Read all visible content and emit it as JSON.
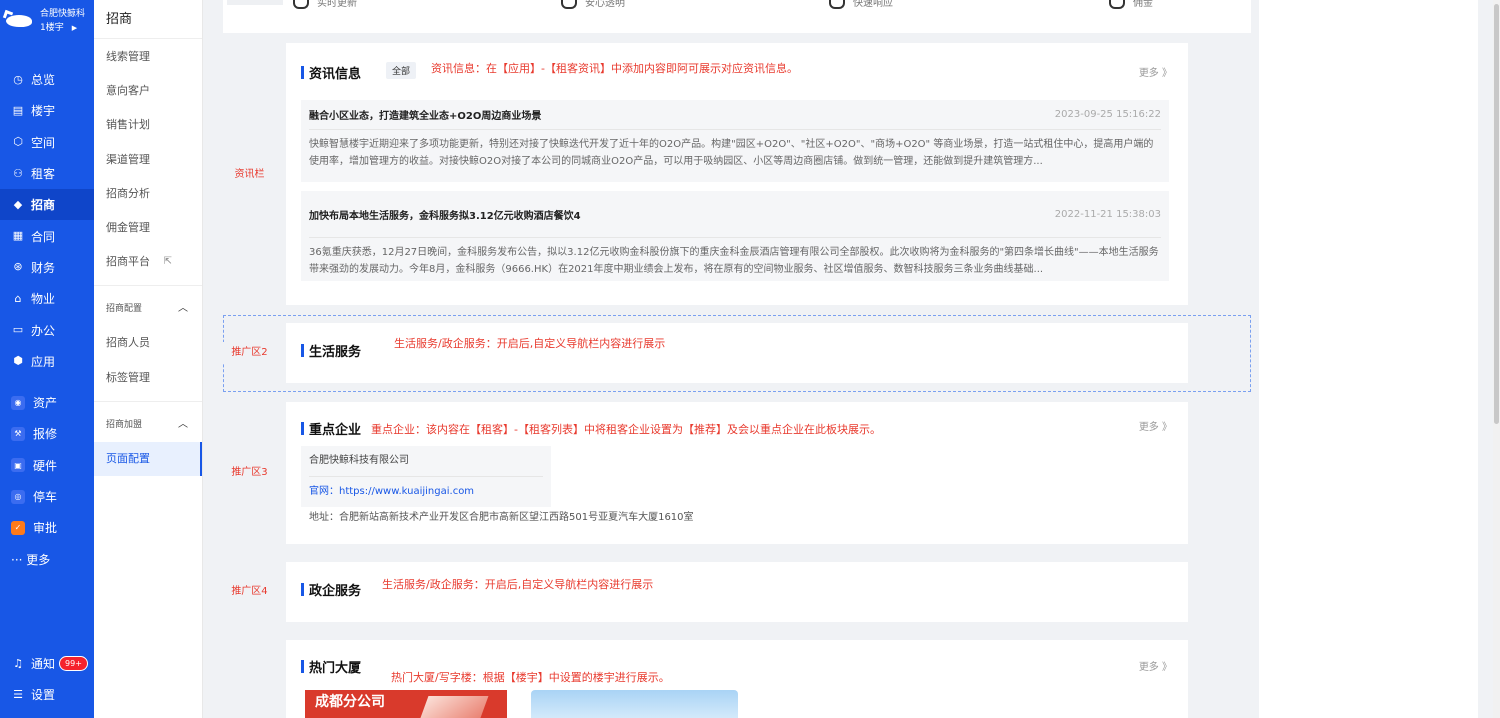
{
  "brand": {
    "name": "合肥快鲸科",
    "sub": "1楼宇"
  },
  "nav": {
    "items": [
      {
        "label": "总览",
        "icon": "clock-icon"
      },
      {
        "label": "楼宇",
        "icon": "building-icon"
      },
      {
        "label": "空间",
        "icon": "cube-icon"
      },
      {
        "label": "租客",
        "icon": "users-icon"
      },
      {
        "label": "招商",
        "icon": "tag-icon"
      },
      {
        "label": "合同",
        "icon": "document-icon"
      },
      {
        "label": "财务",
        "icon": "finance-icon"
      },
      {
        "label": "物业",
        "icon": "home-icon"
      },
      {
        "label": "办公",
        "icon": "monitor-icon"
      },
      {
        "label": "应用",
        "icon": "app-icon"
      }
    ],
    "apps": [
      {
        "label": "资产",
        "color": "#3b6cf0"
      },
      {
        "label": "报修",
        "color": "#3b6cf0"
      },
      {
        "label": "硬件",
        "color": "#3b6cf0"
      },
      {
        "label": "停车",
        "color": "#3b6cf0"
      },
      {
        "label": "审批",
        "color": "#ff7a1a"
      }
    ],
    "more": "··· 更多",
    "notify": "通知",
    "notify_badge": "99+",
    "settings": "设置"
  },
  "sub": {
    "title": "招商",
    "items": [
      "线索管理",
      "意向客户",
      "销售计划",
      "渠道管理",
      "招商分析",
      "佣金管理",
      "招商平台"
    ],
    "group1": "招商配置",
    "group1_items": [
      "招商人员",
      "标签管理"
    ],
    "group2": "招商加盟",
    "group2_items": [
      "页面配置"
    ]
  },
  "top_features": [
    "实时更新",
    "安心透明",
    "快速响应",
    "佣金"
  ],
  "news_section": {
    "tag": "资讯栏",
    "title": "资讯信息",
    "pill": "全部",
    "note": "资讯信息：在【应用】-【租客资讯】中添加内容即阿可展示对应资讯信息。",
    "more": "更多 》",
    "items": [
      {
        "title": "融合小区业态，打造建筑全业态+O2O周边商业场景",
        "time": "2023-09-25 15:16:22",
        "body": "快鲸智慧楼宇近期迎来了多项功能更新，特别还对接了快鲸迭代开发了近十年的O2O产品。构建\"园区+O2O\"、\"社区+O2O\"、\"商场+O2O\" 等商业场景，打造一站式租住中心，提高用户端的使用率，增加管理方的收益。对接快鲸O2O对接了本公司的同城商业O2O产品，可以用于吸纳园区、小区等周边商圈店铺。做到统一管理，还能做到提升建筑管理方..."
      },
      {
        "title": "加快布局本地生活服务，金科服务拟3.12亿元收购酒店餐饮4",
        "time": "2022-11-21 15:38:03",
        "body": "36氪重庆获悉，12月27日晚间，金科服务发布公告，拟以3.12亿元收购金科股份旗下的重庆金科金辰酒店管理有限公司全部股权。此次收购将为金科服务的\"第四条增长曲线\"——本地生活服务带来强劲的发展动力。今年8月，金科服务（9666.HK）在2021年度中期业绩会上发布，将在原有的空间物业服务、社区增值服务、数智科技服务三条业务曲线基础..."
      }
    ]
  },
  "life_section": {
    "tag": "推广区2",
    "title": "生活服务",
    "note": "生活服务/政企服务：开启后,自定义导航栏内容进行展示"
  },
  "key_section": {
    "tag": "推广区3",
    "title": "重点企业",
    "note": "重点企业：该内容在【租客】-【租客列表】中将租客企业设置为【推荐】及会以重点企业在此板块展示。",
    "more": "更多 》",
    "company": "合肥快鲸科技有限公司",
    "site": "官网：https://www.kuaijingai.com",
    "addr": "地址：合肥新站高新技术产业开发区合肥市高新区望江西路501号亚夏汽车大厦1610室"
  },
  "gov_section": {
    "tag": "推广区4",
    "title": "政企服务",
    "note": "生活服务/政企服务：开启后,自定义导航栏内容进行展示"
  },
  "hot_section": {
    "title": "热门大厦",
    "note": "热门大厦/写字楼：根据【楼宇】中设置的楼宇进行展示。",
    "more": "更多 》",
    "thumb1_text": "成都分公司"
  }
}
